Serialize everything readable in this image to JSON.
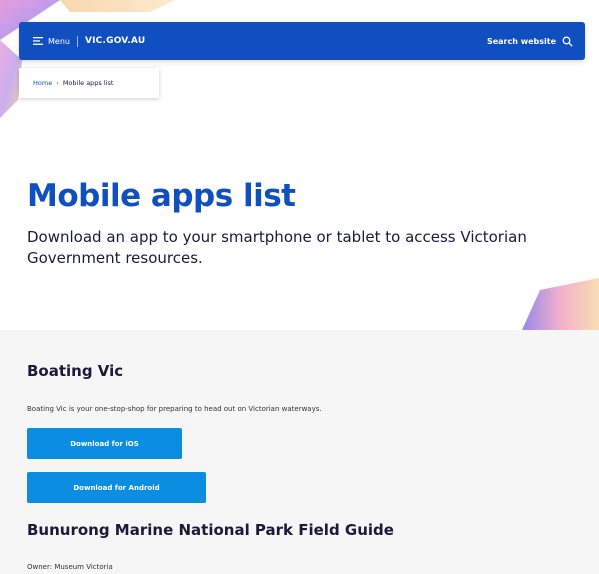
{
  "header": {
    "menu_label": "Menu",
    "brand": "VIC.GOV.AU",
    "search_label": "Search website"
  },
  "breadcrumb": {
    "home": "Home",
    "current": "Mobile apps list"
  },
  "page": {
    "title": "Mobile apps list",
    "intro": "Download an app to your smartphone or tablet to access Victorian Government resources."
  },
  "apps": [
    {
      "title": "Boating Vic",
      "description": "Boating Vic is your one-stop-shop for preparing to head out on Victorian waterways.",
      "ios_button": "Download for iOS",
      "android_button": "Download for Android"
    },
    {
      "title": "Bunurong Marine National Park Field Guide",
      "owner": "Owner: Museum Victoria"
    }
  ],
  "colors": {
    "brand_blue": "#0f4fbf",
    "button_blue": "#0b8de2",
    "heading_dark": "#1a1a3a",
    "content_bg": "#f6f6f7"
  }
}
